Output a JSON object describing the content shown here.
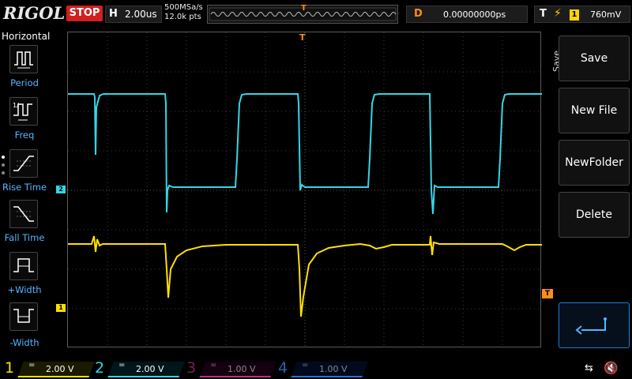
{
  "topbar": {
    "brand": "RIGOL",
    "run_state": "STOP",
    "horizontal_label": "H",
    "timebase": "2.00us",
    "sample_rate": "500MSa/s",
    "memory_depth": "12.0k pts",
    "delay_label": "D",
    "delay_value": "0.00000000ps",
    "trigger_label": "T",
    "trigger_source": "1",
    "trigger_level": "760mV"
  },
  "left_menu": {
    "title": "Horizontal",
    "items": [
      {
        "label": "Period",
        "icon": "period-icon"
      },
      {
        "label": "Freq",
        "icon": "frequency-icon"
      },
      {
        "label": "Rise Time",
        "icon": "rise-time-icon"
      },
      {
        "label": "Fall Time",
        "icon": "fall-time-icon"
      },
      {
        "label": "+Width",
        "icon": "positive-width-icon"
      },
      {
        "label": "-Width",
        "icon": "negative-width-icon"
      }
    ]
  },
  "right_menu": {
    "title": "Save",
    "buttons": [
      "Save",
      "New File",
      "NewFolder",
      "Delete"
    ],
    "back_icon": "back-arrow-icon"
  },
  "markers": {
    "ch1": "1",
    "ch2": "2",
    "trigger_top": "T",
    "trigger_level": "T"
  },
  "channels": [
    {
      "num": "1",
      "coupling": "=",
      "scale": "2.00 V",
      "color": "#ffe000",
      "active": true
    },
    {
      "num": "2",
      "coupling": "=",
      "scale": "2.00 V",
      "color": "#33d6e6",
      "active": true
    },
    {
      "num": "3",
      "coupling": "=",
      "scale": "1.00 V",
      "color": "#c0307f",
      "active": false
    },
    {
      "num": "4",
      "coupling": "=",
      "scale": "1.00 V",
      "color": "#2e6fd8",
      "active": false
    }
  ],
  "colors": {
    "ch1": "#ffe000",
    "ch2": "#33d6e6",
    "trigger": "#ff8c1a",
    "stop": "#d21f1f",
    "menu_label": "#4fb7ff"
  }
}
